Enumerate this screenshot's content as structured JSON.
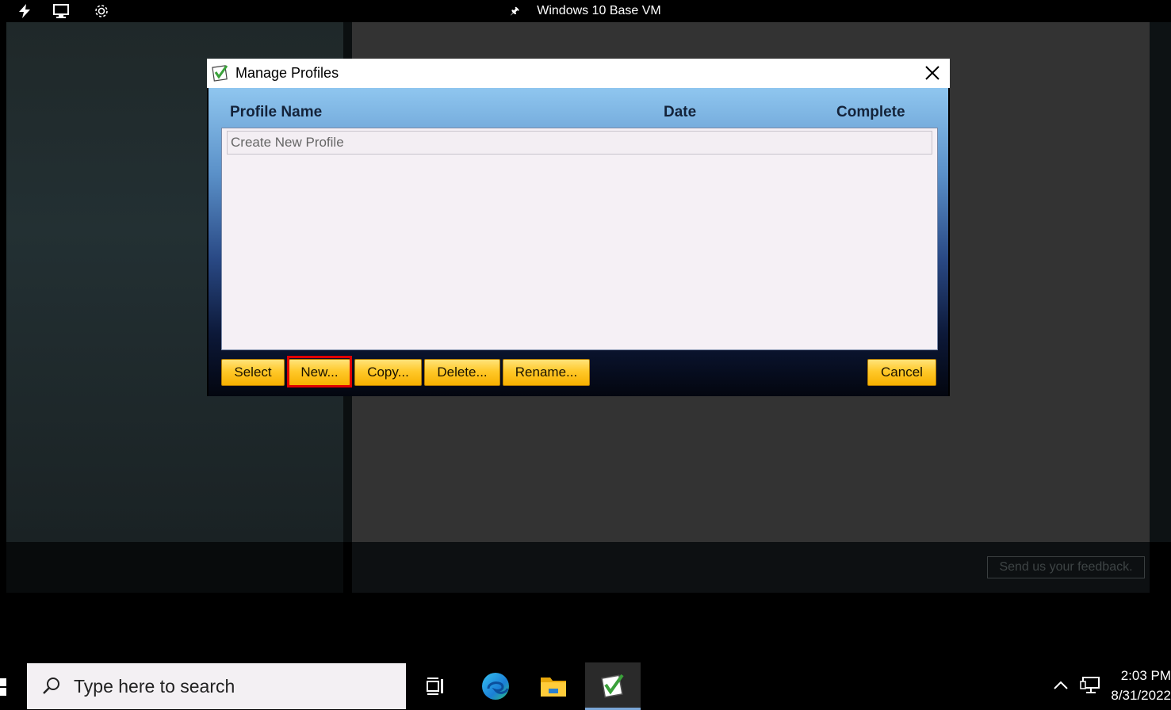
{
  "vm_bar": {
    "title": "Windows 10 Base VM",
    "icons": [
      "lightning-icon",
      "monitor-icon",
      "gear-icon",
      "pin-icon"
    ]
  },
  "background_app": {
    "feedback_label": "Send us your feedback."
  },
  "dialog": {
    "title": "Manage Profiles",
    "columns": [
      "Profile Name",
      "Date",
      "Complete"
    ],
    "rows": [
      "Create New Profile"
    ],
    "buttons": {
      "select": "Select",
      "new": "New...",
      "copy": "Copy...",
      "delete": "Delete...",
      "rename": "Rename...",
      "cancel": "Cancel"
    },
    "highlighted_button": "New...",
    "colors": {
      "button": "#ffc92a",
      "highlight": "#e00000"
    }
  },
  "taskbar": {
    "search_placeholder": "Type here to search",
    "time": "2:03 PM",
    "date": "8/31/2022",
    "pinned": [
      "task-view-icon",
      "edge-icon",
      "file-explorer-icon",
      "profile-app-icon"
    ]
  }
}
